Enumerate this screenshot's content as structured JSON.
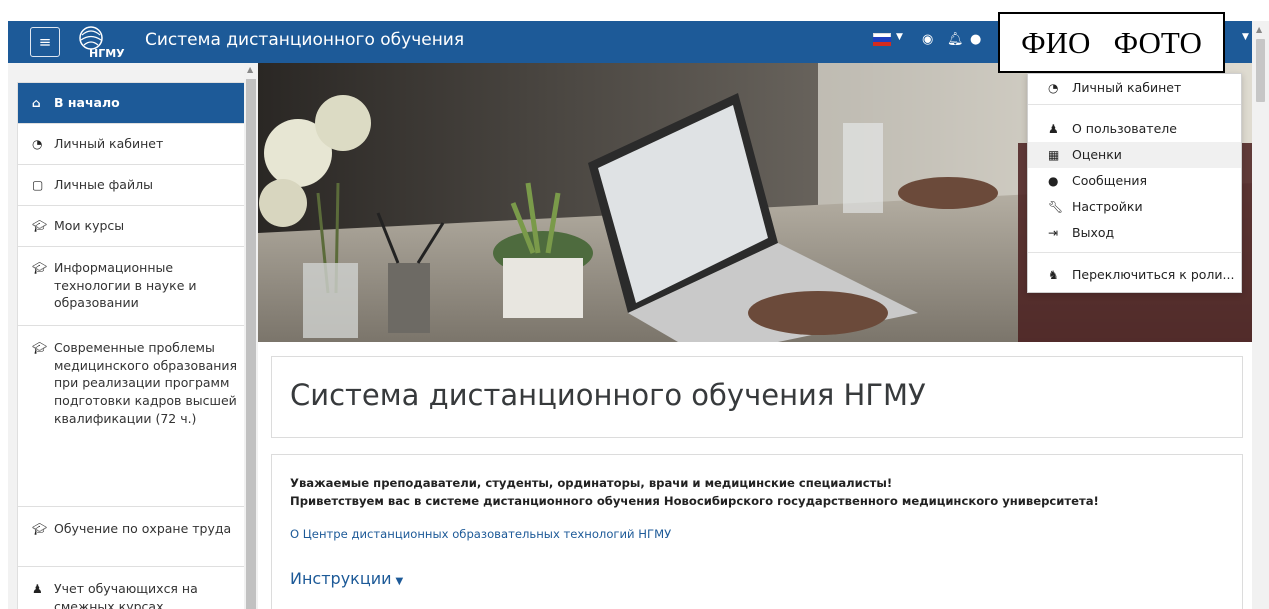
{
  "navbar": {
    "menu_icon": "hamburger-icon",
    "logo_text": "НГМУ",
    "site_title": "Система дистанционного обучения",
    "language_flag": "russia-flag-icon",
    "icons": [
      "eye-icon",
      "bell-icon",
      "comment-icon"
    ]
  },
  "overlay": {
    "text": "ФИО   ФОТО"
  },
  "user_menu": {
    "items": [
      {
        "icon": "tachometer-icon",
        "label": "Личный кабинет"
      },
      {
        "icon": "user-icon",
        "label": "О пользователе"
      },
      {
        "icon": "table-icon",
        "label": "Оценки"
      },
      {
        "icon": "comment-icon",
        "label": "Сообщения"
      },
      {
        "icon": "wrench-icon",
        "label": "Настройки"
      },
      {
        "icon": "sign-out-icon",
        "label": "Выход"
      },
      {
        "icon": "user-secret-icon",
        "label": "Переключиться к роли..."
      }
    ]
  },
  "sidebar": {
    "items": [
      {
        "icon": "home-icon",
        "label": "В начало",
        "active": true
      },
      {
        "icon": "tachometer-icon",
        "label": "Личный кабинет"
      },
      {
        "icon": "file-icon",
        "label": "Личные файлы"
      },
      {
        "icon": "graduation-cap-icon",
        "label": "Мои курсы"
      },
      {
        "icon": "graduation-cap-icon",
        "label": "Информационные технологии в науке и образовании"
      },
      {
        "icon": "graduation-cap-icon",
        "label": "Современные проблемы медицинского образования при реализации программ подготовки кадров высшей квалификации (72 ч.)"
      },
      {
        "icon": "graduation-cap-icon",
        "label": "Обучение по охране труда"
      },
      {
        "icon": "user-icon",
        "label": "Учет обучающихся на смежных курсах"
      }
    ]
  },
  "main": {
    "page_title": "Система дистанционного обучения НГМУ",
    "welcome_line1": "Уважаемые преподаватели, студенты, ординаторы, врачи и медицинские специалисты!",
    "welcome_line2": "Приветствуем вас в системе дистанционного обучения Новосибирского государственного медицинского университета!",
    "center_link": "О Центре дистанционных образовательных технологий НГМУ",
    "instructions_label": "Инструкции"
  },
  "colors": {
    "brand": "#1d5a98",
    "sidebar_bg": "#f2f2f2",
    "link": "#1d5a98"
  }
}
